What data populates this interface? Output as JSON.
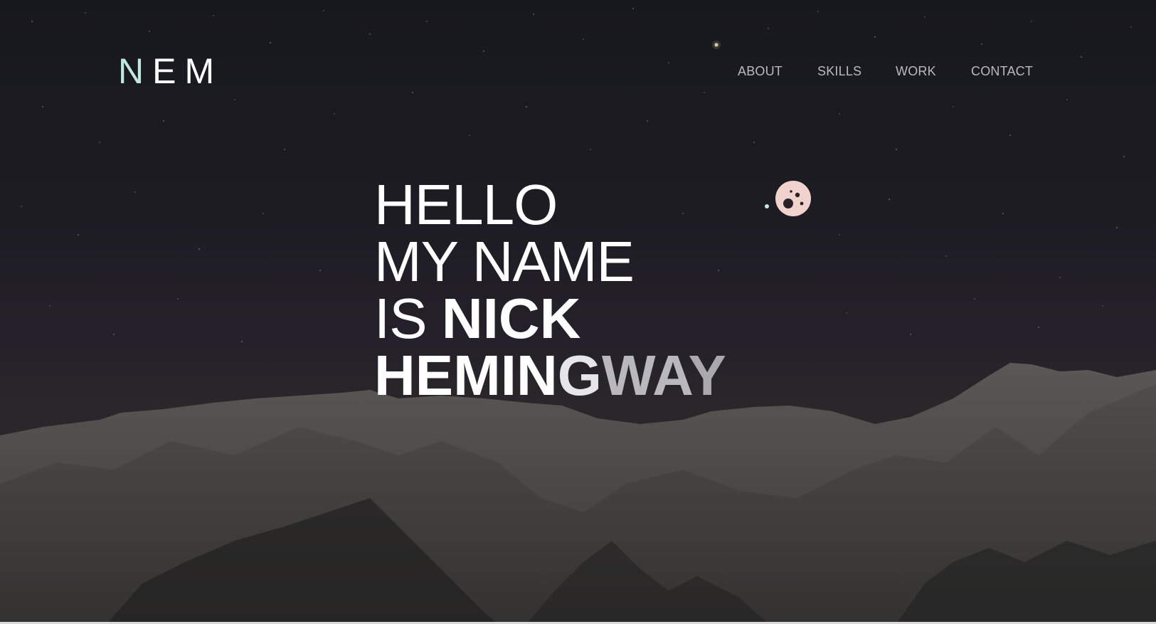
{
  "logo": {
    "first_letter": "N",
    "rest": "EM"
  },
  "nav": {
    "items": [
      {
        "label": "ABOUT"
      },
      {
        "label": "SKILLS"
      },
      {
        "label": "WORK"
      },
      {
        "label": "CONTACT"
      }
    ]
  },
  "hero": {
    "line1": "HELLO",
    "line2": "MY NAME",
    "line3_prefix": "IS ",
    "line3_name": "NICK",
    "line4_part1": "HEMIN",
    "line4_part2": "G",
    "line4_part3": "WA",
    "line4_part4": "Y"
  },
  "colors": {
    "logo_accent": "#bfe8e0",
    "text": "#ffffff",
    "nav_text": "#b9b9bf",
    "planet": "#f1d3cd",
    "background": "#1b1b22"
  },
  "icons": {
    "planet": "planet-icon"
  }
}
